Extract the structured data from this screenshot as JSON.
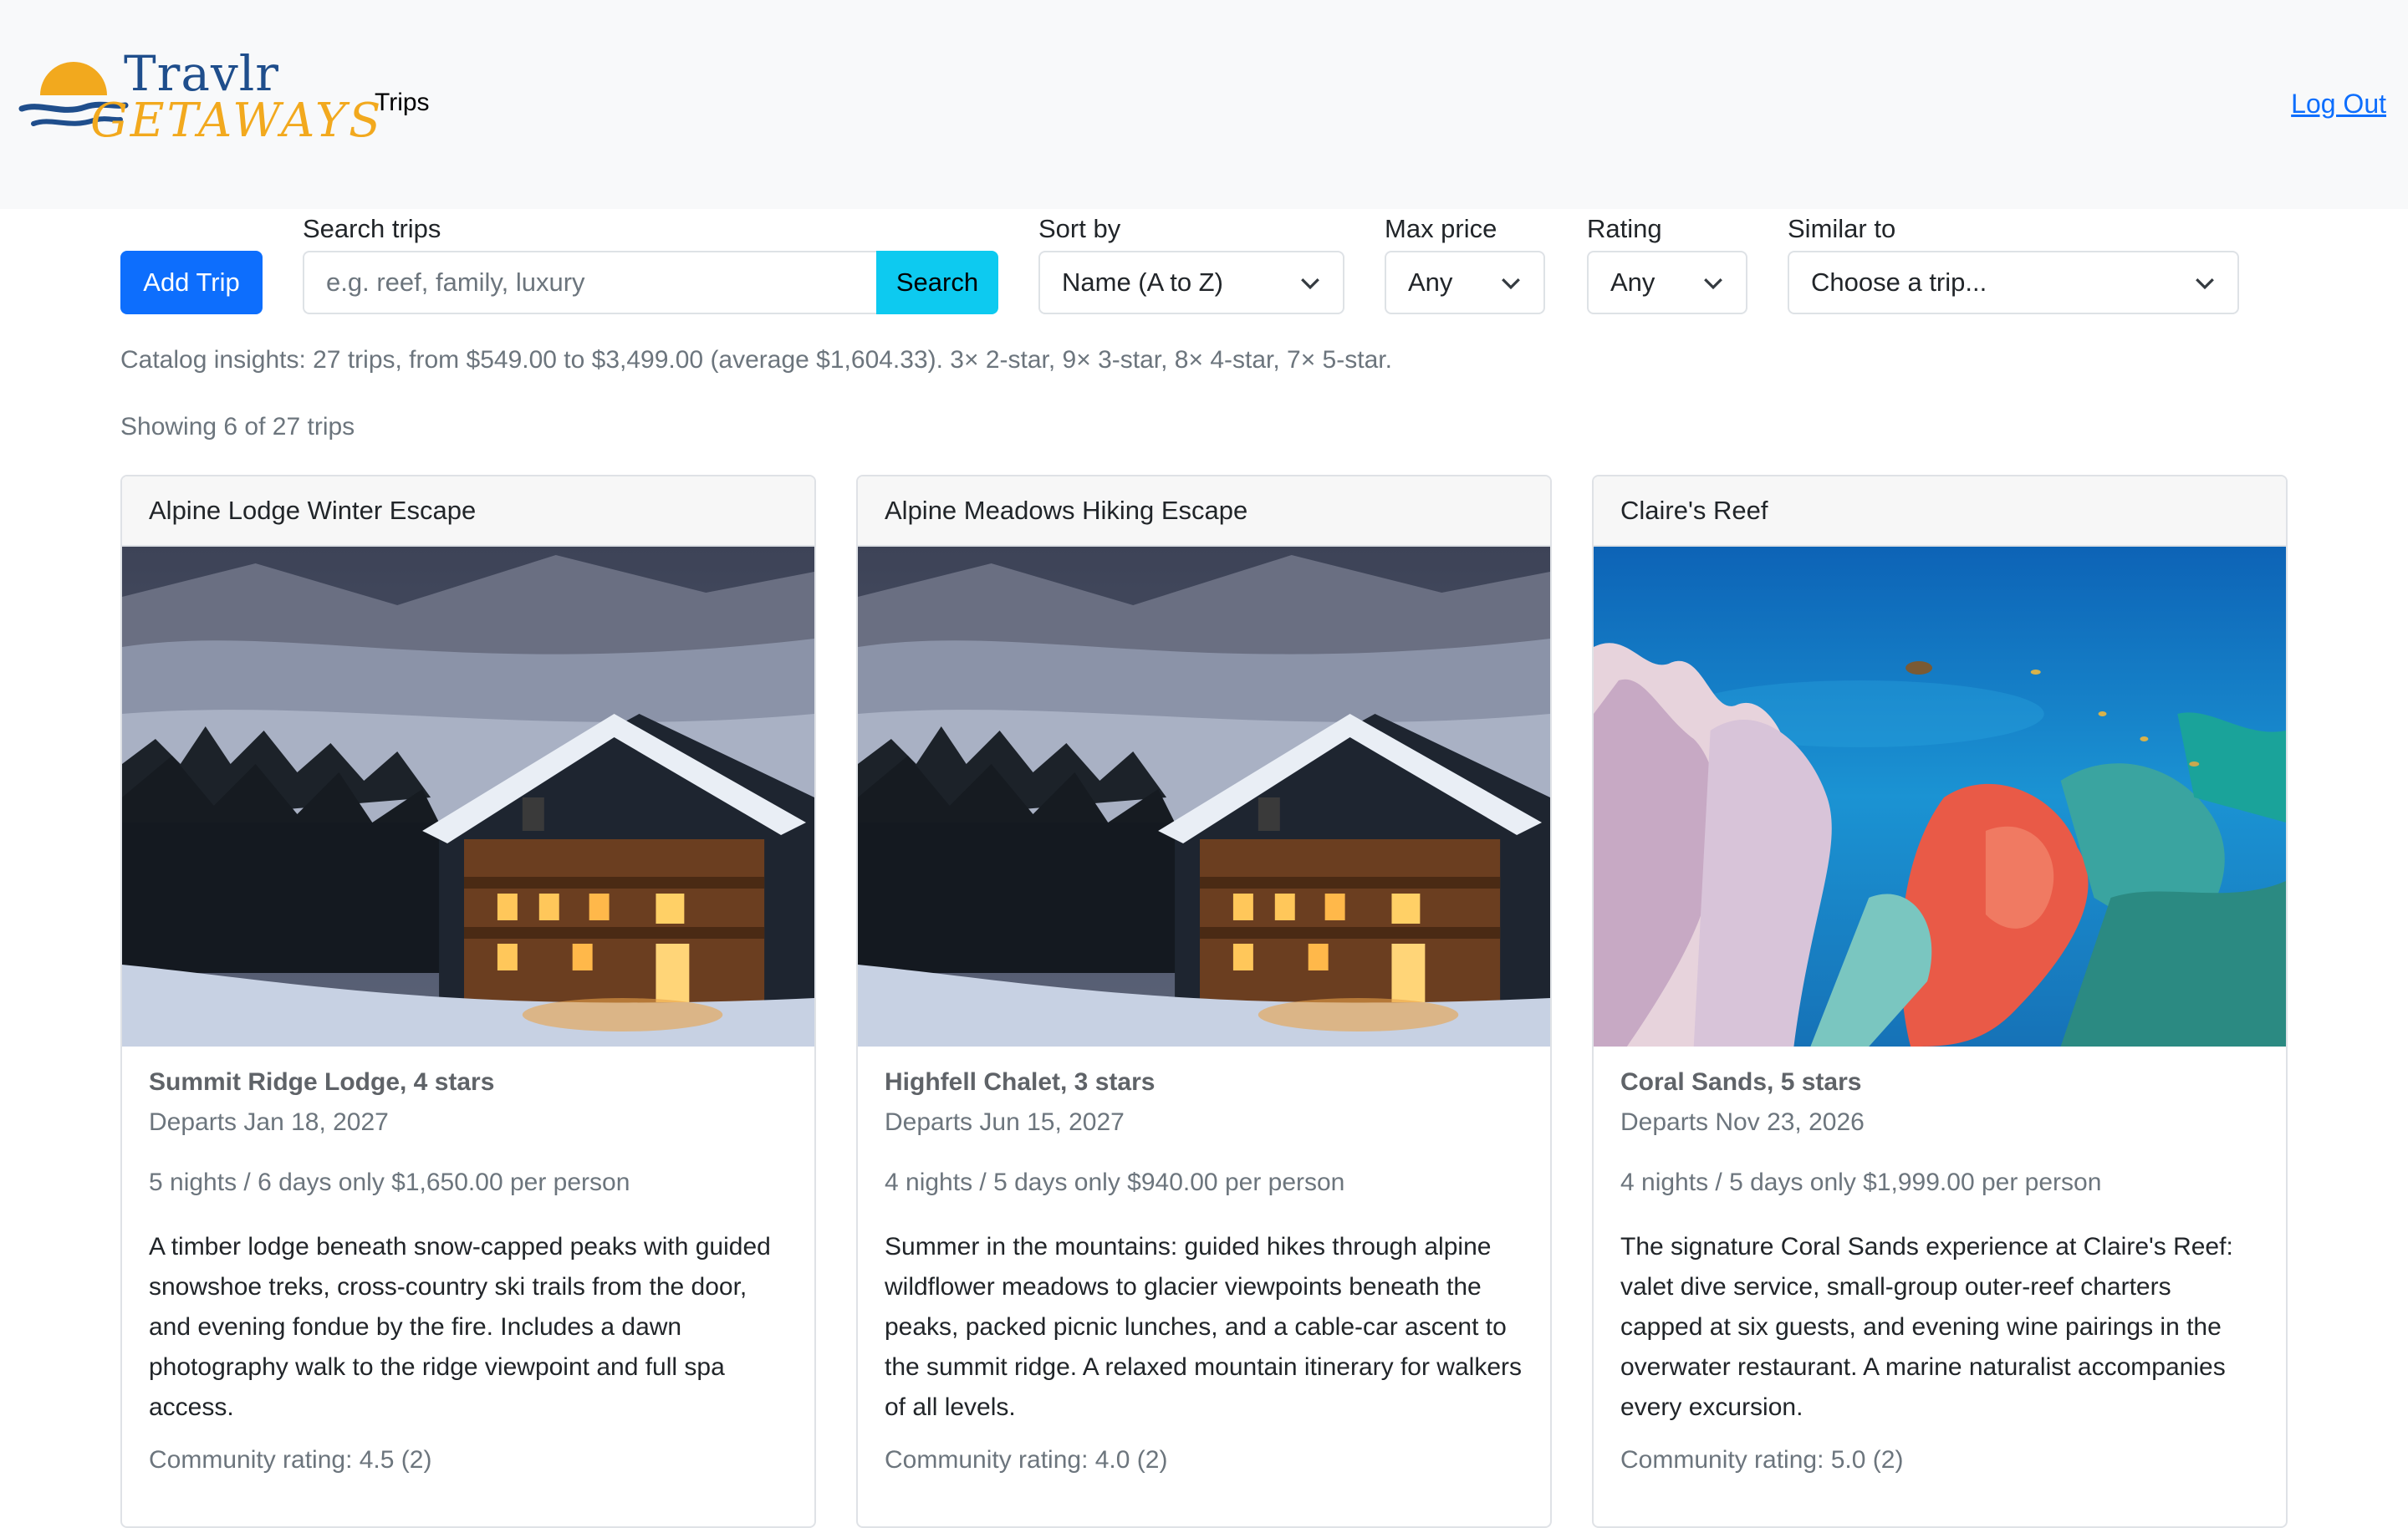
{
  "brand": {
    "line1": "Travlr",
    "line2": "GETAWAYS"
  },
  "nav": {
    "trips": "Trips",
    "logout": "Log Out"
  },
  "toolbar": {
    "add_trip": "Add Trip",
    "search_label": "Search trips",
    "search_placeholder": "e.g. reef, family, luxury",
    "search_button": "Search",
    "sort_label": "Sort by",
    "sort_value": "Name (A to Z)",
    "max_price_label": "Max price",
    "max_price_value": "Any",
    "rating_label": "Rating",
    "rating_value": "Any",
    "similar_label": "Similar to",
    "similar_value": "Choose a trip..."
  },
  "insights": "Catalog insights: 27 trips, from $549.00 to $3,499.00 (average $1,604.33). 3× 2-star, 9× 3-star, 8× 4-star, 7× 5-star.",
  "showing": "Showing 6 of 27 trips",
  "cards": [
    {
      "title": "Alpine Lodge Winter Escape",
      "image": "snowy-lodge",
      "resort": "Summit Ridge Lodge, 4 stars",
      "departs": "Departs Jan 18, 2027",
      "price": "5 nights / 6 days only $1,650.00 per person",
      "description": "A timber lodge beneath snow-capped peaks with guided snowshoe treks, cross-country ski trails from the door, and evening fondue by the fire. Includes a dawn photography walk to the ridge viewpoint and full spa access.",
      "rating": "Community rating: 4.5 (2)"
    },
    {
      "title": "Alpine Meadows Hiking Escape",
      "image": "snowy-lodge",
      "resort": "Highfell Chalet, 3 stars",
      "departs": "Departs Jun 15, 2027",
      "price": "4 nights / 5 days only $940.00 per person",
      "description": "Summer in the mountains: guided hikes through alpine wildflower meadows to glacier viewpoints beneath the peaks, packed picnic lunches, and a cable-car ascent to the summit ridge. A relaxed mountain itinerary for walkers of all levels.",
      "rating": "Community rating: 4.0 (2)"
    },
    {
      "title": "Claire's Reef",
      "image": "coral-reef",
      "resort": "Coral Sands, 5 stars",
      "departs": "Departs Nov 23, 2026",
      "price": "4 nights / 5 days only $1,999.00 per person",
      "description": "The signature Coral Sands experience at Claire's Reef: valet dive service, small-group outer-reef charters capped at six guests, and evening wine pairings in the overwater restaurant. A marine naturalist accompanies every excursion.",
      "rating": "Community rating: 5.0 (2)"
    }
  ]
}
